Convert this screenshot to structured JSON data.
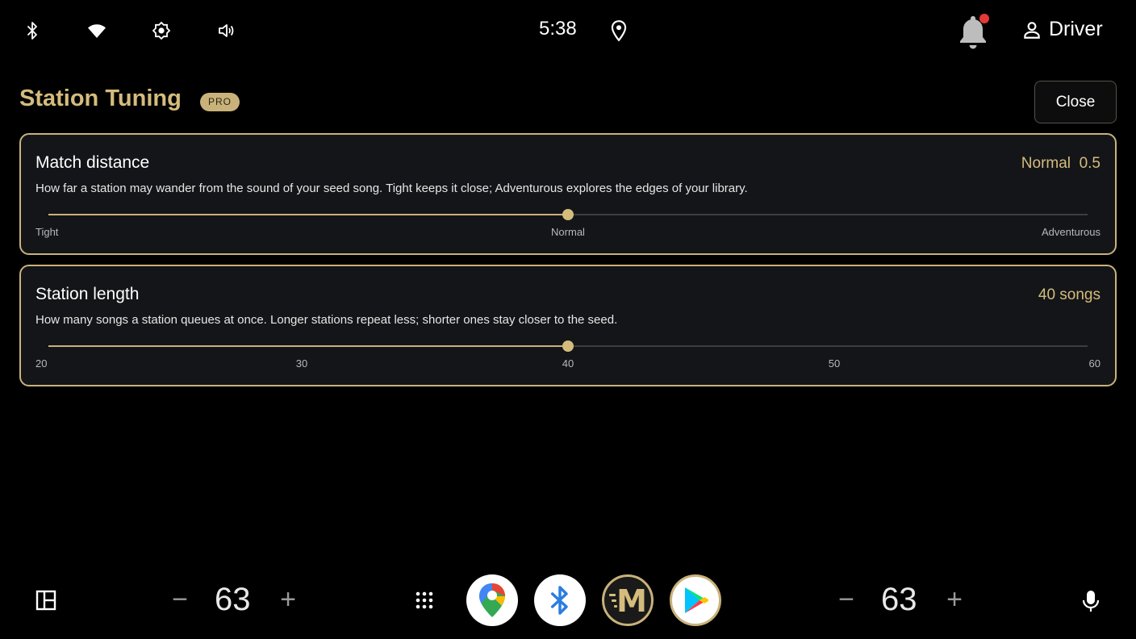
{
  "status_bar": {
    "time": "5:38",
    "icons": [
      "bluetooth-icon",
      "wifi-icon",
      "brightness-icon",
      "volume-icon",
      "location-icon",
      "notification-bell-icon",
      "profile-icon"
    ],
    "user_label": "Driver",
    "notification_dot_color": "#e53935"
  },
  "header": {
    "title": "Station Tuning",
    "badge": "PRO",
    "close_label": "Close"
  },
  "settings": [
    {
      "title": "Match distance",
      "value_text": "Normal  0.5",
      "description": "How far a station may wander from the sound of your seed song. Tight keeps it close; Adventurous explores the edges of your library.",
      "slider_fraction": 0.5,
      "ticks": [
        "Tight",
        "Normal",
        "Adventurous"
      ]
    },
    {
      "title": "Station length",
      "value_text": "40 songs",
      "description": "How many songs a station queues at once. Longer stations repeat less; shorter ones stay closer to the seed.",
      "slider_fraction": 0.5,
      "ticks": [
        "20",
        "30",
        "40",
        "50",
        "60"
      ]
    }
  ],
  "bottom_bar": {
    "left_volume": "63",
    "right_volume": "63",
    "minus_symbol": "−",
    "plus_symbol": "+",
    "apps": [
      "maps-app-icon",
      "bluetooth-app-icon",
      "music-app-icon",
      "play-store-app-icon"
    ],
    "music_app_letter": "M"
  },
  "colors": {
    "accent": "#c9b27a",
    "accent_text": "#d4bc7c",
    "card_bg": "#141518",
    "background": "#000000"
  }
}
